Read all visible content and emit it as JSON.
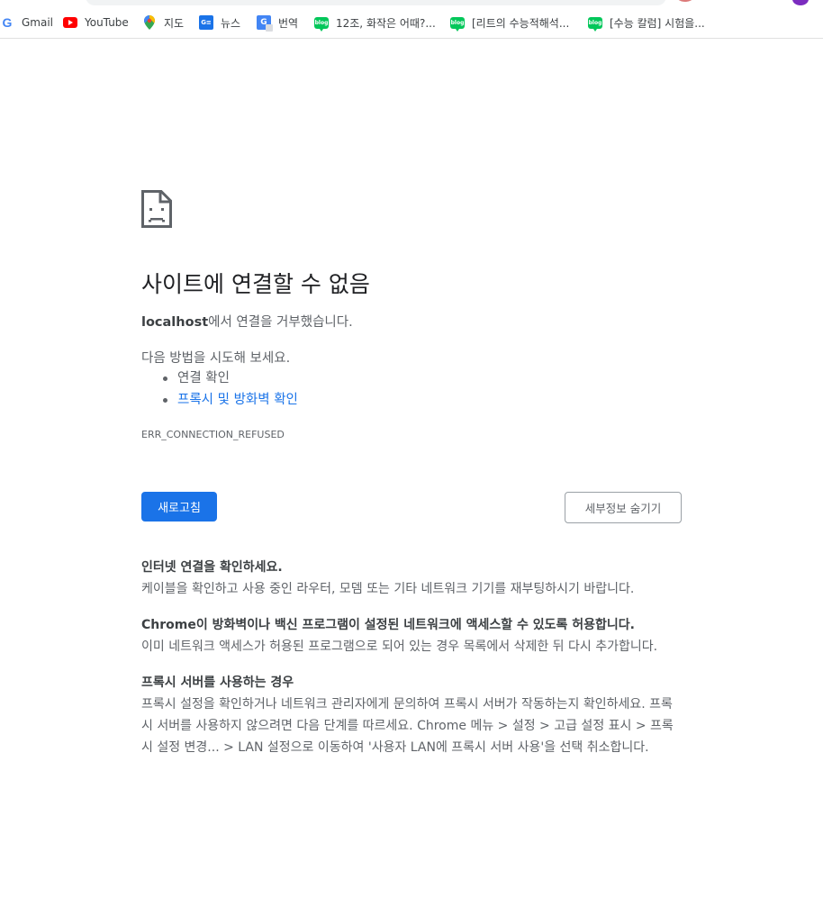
{
  "bookmarks": [
    {
      "icon": "google-g-icon",
      "label": "Gmail"
    },
    {
      "icon": "youtube-icon",
      "label": "YouTube"
    },
    {
      "icon": "maps-pin-icon",
      "label": "지도"
    },
    {
      "icon": "news-icon",
      "label": "뉴스"
    },
    {
      "icon": "translate-icon",
      "label": "번역"
    },
    {
      "icon": "naver-blog-icon",
      "label": "12조, 화작은 어때?..."
    },
    {
      "icon": "naver-blog-icon",
      "label": "[리트의 수능적해석..."
    },
    {
      "icon": "naver-blog-icon",
      "label": "[수능 칼럼] 시험을..."
    }
  ],
  "icon_text": {
    "google": "G",
    "news": "G≡",
    "translate": "G",
    "blog": "blog"
  },
  "error": {
    "title": "사이트에 연결할 수 없음",
    "host": "localhost",
    "host_suffix": "에서 연결을 거부했습니다.",
    "try_label": "다음 방법을 시도해 보세요.",
    "suggestions": [
      {
        "label": "연결 확인",
        "link": false
      },
      {
        "label": "프록시 및 방화벽 확인",
        "link": true
      }
    ],
    "code": "ERR_CONNECTION_REFUSED",
    "reload_label": "새로고침",
    "details_label": "세부정보 숨기기"
  },
  "details": {
    "sections": [
      {
        "heading": "인터넷 연결을 확인하세요.",
        "body": "케이블을 확인하고 사용 중인 라우터, 모뎀 또는 기타 네트워크 기기를 재부팅하시기 바랍니다."
      },
      {
        "heading": "Chrome이 방화벽이나 백신 프로그램이 설정된 네트워크에 액세스할 수 있도록 허용합니다.",
        "body": "이미 네트워크 액세스가 허용된 프로그램으로 되어 있는 경우 목록에서 삭제한 뒤 다시 추가합니다."
      },
      {
        "heading": "프록시 서버를 사용하는 경우",
        "body": "프록시 설정을 확인하거나 네트워크 관리자에게 문의하여 프록시 서버가 작동하는지 확인하세요. 프록시 서버를 사용하지 않으려면 다음 단계를 따르세요. Chrome 메뉴 > 설정 > 고급 설정 표시 > 프록시 설정 변경... > LAN 설정으로 이동하여 '사용자 LAN에 프록시 서버 사용'을 선택 취소합니다."
      }
    ]
  },
  "colors": {
    "primary_button": "#1a73e8",
    "link": "#1a73e8",
    "text_secondary": "#5f6368"
  }
}
